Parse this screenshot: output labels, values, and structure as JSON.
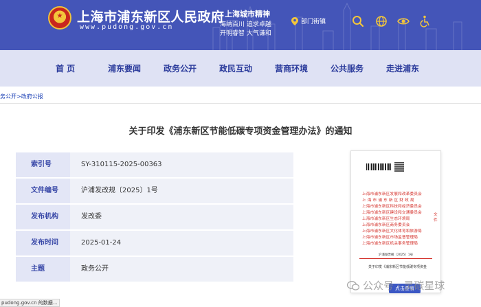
{
  "header": {
    "site_title": "上海市浦东新区人民政府",
    "site_url": "www.pudong.gov.cn",
    "spirit_title": "上海城市精神",
    "spirit_line1": "海纳百川  追求卓越",
    "spirit_line2": "开明睿智  大气谦和",
    "dept_label": "部门街镇",
    "icons": [
      "map-pin-icon",
      "search-icon",
      "globe-icon",
      "eye-icon",
      "accessibility-icon"
    ]
  },
  "nav": {
    "items": [
      "首  页",
      "浦东要闻",
      "政务公开",
      "政民互动",
      "营商环境",
      "公共服务",
      "走进浦东"
    ]
  },
  "breadcrumb": {
    "item1": "务公开",
    "sep": ">",
    "item2": "政府公报"
  },
  "document": {
    "title": "关于印发《浦东新区节能低碳专项资金管理办法》的通知",
    "meta": [
      {
        "label": "索引号",
        "value": "SY-310115-2025-00363"
      },
      {
        "label": "文件编号",
        "value": "沪浦发改规〔2025〕1号"
      },
      {
        "label": "发布机构",
        "value": "发改委"
      },
      {
        "label": "发布时间",
        "value": "2025-01-24"
      },
      {
        "label": "主题",
        "value": "政务公开"
      }
    ]
  },
  "preview": {
    "issuers": [
      "上海市浦东新区发展和改革委员会",
      "上 海 市 浦 东 新 区 财 政 局",
      "上海市浦东新区科技和经济委员会",
      "上海市浦东新区建设和交通委员会",
      "上海市浦东新区生态环境局",
      "上海市浦东新区商务委员会",
      "上海市浦东新区文化体育和旅游局",
      "上海市浦东新区市场监督管理局",
      "上海市浦东新区机关事务管理局"
    ],
    "issuer_tail": "文件",
    "doc_number": "沪浦发改规〔2025〕1号",
    "subtitle": "关于印发《浦东新区节能低碳专项资金",
    "view_button": "点击查看"
  },
  "watermark": "公众号 · 灵碳星球",
  "status_bar": "pudong.gov.cn 的数据...",
  "colors": {
    "header_bg": "#4455b8",
    "nav_bg": "#dfe2f4",
    "nav_text": "#2a3a9b",
    "label_bg": "#e3e6f6",
    "value_bg": "#eff1f8",
    "issuer_red": "#d4302a",
    "button_blue": "#3b57c4"
  }
}
